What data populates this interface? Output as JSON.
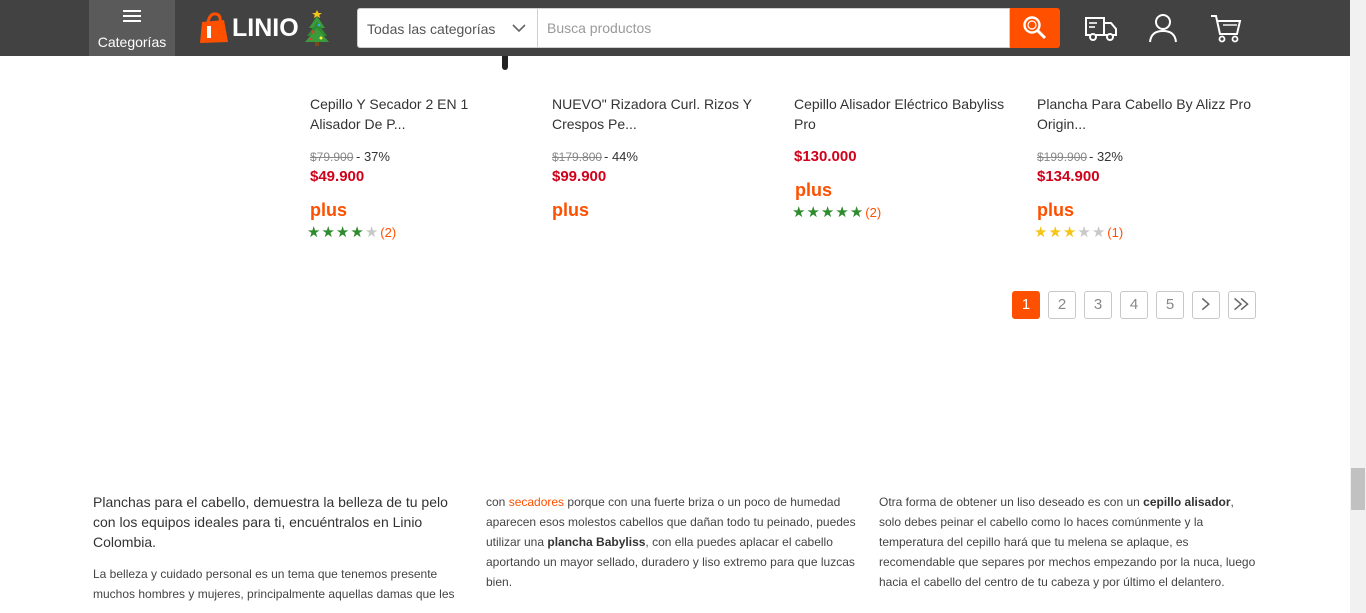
{
  "header": {
    "menu_label": "Categorías",
    "logo_text": "LINIO",
    "category_select": "Todas las categorías",
    "search_placeholder": "Busca productos",
    "brand_color": "#ff5000",
    "icons": [
      "menu-icon",
      "tree-icon",
      "chevron-down-icon",
      "search-icon",
      "truck-icon",
      "user-icon",
      "cart-icon"
    ]
  },
  "products": [
    {
      "name_line1": "Cepillo Y Secador 2 EN 1",
      "name_line2": "Alisador De P...",
      "old_price": "$79.900",
      "discount": "- 37%",
      "price": "$49.900",
      "plus": "plus",
      "rating": 4,
      "star_color": "green",
      "reviews": "(2)"
    },
    {
      "name_line1": "NUEVO\" Rizadora Curl. Rizos Y",
      "name_line2": "Crespos Pe...",
      "old_price": "$179.800",
      "discount": "- 44%",
      "price": "$99.900",
      "plus": "plus"
    },
    {
      "name_line1": "Cepillo Alisador Eléctrico Babyliss",
      "name_line2": "Pro",
      "price": "$130.000",
      "plus": "plus",
      "rating": 5,
      "star_color": "green",
      "reviews": "(2)"
    },
    {
      "name_line1": "Plancha Para Cabello By Alizz Pro",
      "name_line2": "Origin...",
      "old_price": "$199.900",
      "discount": "- 32%",
      "price": "$134.900",
      "plus": "plus",
      "rating": 3,
      "star_color": "yellow",
      "reviews": "(1)"
    }
  ],
  "pagination": {
    "pages": [
      "1",
      "2",
      "3",
      "4",
      "5"
    ],
    "current": "1",
    "next": "›",
    "last": "»"
  },
  "seo": {
    "col1": {
      "lead": "Planchas para el cabello, demuestra la belleza de tu pelo con los equipos ideales para ti, encuéntralos en Linio Colombia.",
      "para_line1": "La belleza y cuidado personal es un tema que tenemos presente",
      "para_line2": "muchos hombres y mujeres, principalmente aquellas damas que les"
    },
    "col2": {
      "p1_a": "con ",
      "p1_link": "secadores",
      "p1_b": " porque con una fuerte briza o un poco de humedad aparecen esos molestos cabellos que dañan todo tu peinado, puedes utilizar una ",
      "p1_bold": "plancha Babyliss",
      "p1_c": ", con ella puedes aplacar el cabello aportando un mayor sellado, duradero y liso extremo para que luzcas bien."
    },
    "col3": {
      "p1_a": "Otra forma de obtener un liso deseado es con un ",
      "p1_bold": "cepillo alisador",
      "p1_b": ", solo debes peinar el cabello como lo haces comúnmente y la temperatura del cepillo hará que tu melena se aplaque, es recomendable que separes por mechos empezando por la nuca, luego hacia el cabello del centro de tu cabeza y por último el delantero."
    }
  }
}
